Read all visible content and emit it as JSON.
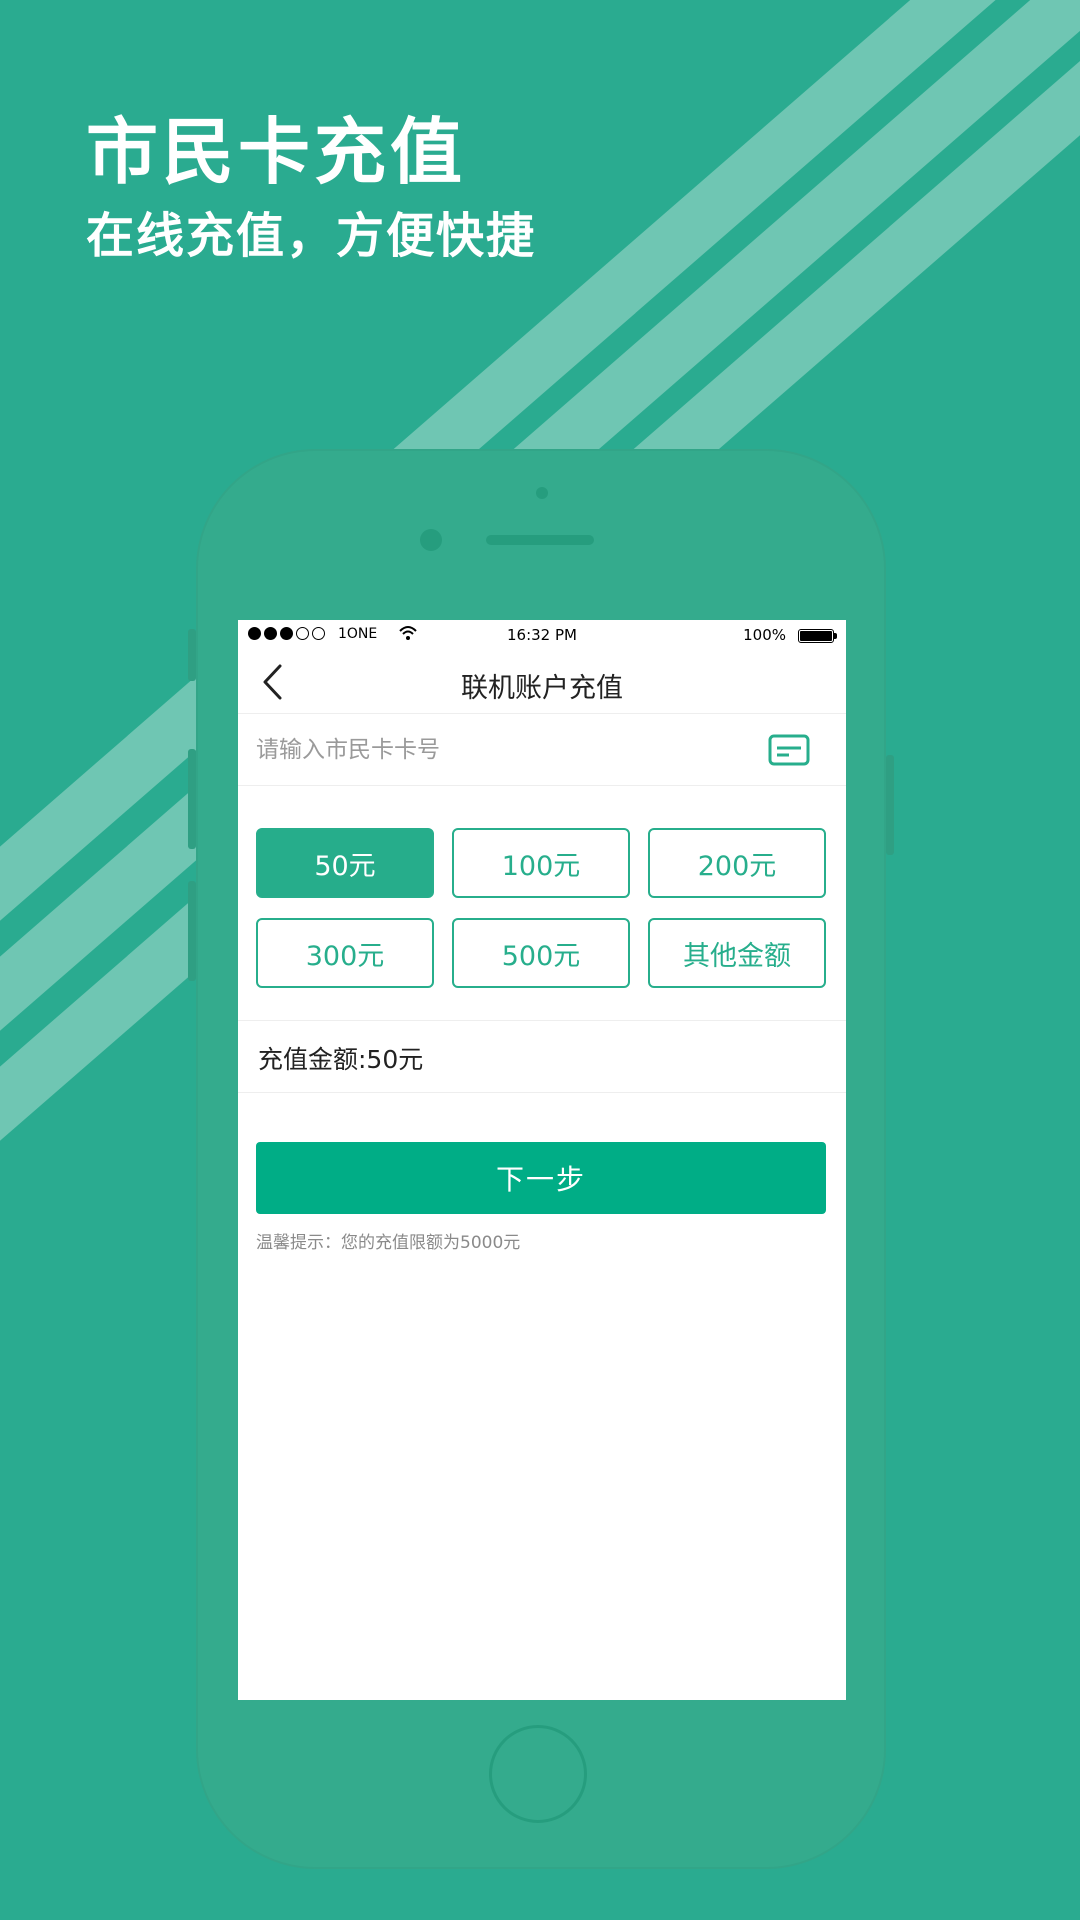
{
  "hero": {
    "title": "市民卡充值",
    "subtitle": "在线充值，方便快捷"
  },
  "status_bar": {
    "carrier": "1ONE",
    "time": "16:32 PM",
    "battery": "100%",
    "signal_icon": "signal-dots-icon",
    "wifi_icon": "wifi-icon",
    "battery_icon": "battery-icon"
  },
  "nav": {
    "back_icon": "chevron-left-icon",
    "title": "联机账户充值"
  },
  "card_input": {
    "value": "",
    "placeholder": "请输入市民卡卡号",
    "icon": "card-icon"
  },
  "amounts": {
    "options": [
      "50元",
      "100元",
      "200元",
      "300元",
      "500元",
      "其他金额"
    ],
    "selected_index": 0
  },
  "summary": {
    "text": "充值金额:50元"
  },
  "actions": {
    "next_label": "下一步"
  },
  "tip": {
    "text": "温馨提示：您的充值限额为5000元"
  },
  "colors": {
    "background": "#2aab90",
    "accent": "#26ad8b",
    "button": "#00ad86",
    "stripe": "#6fc6b3",
    "phone_body": "#34ab8d"
  }
}
